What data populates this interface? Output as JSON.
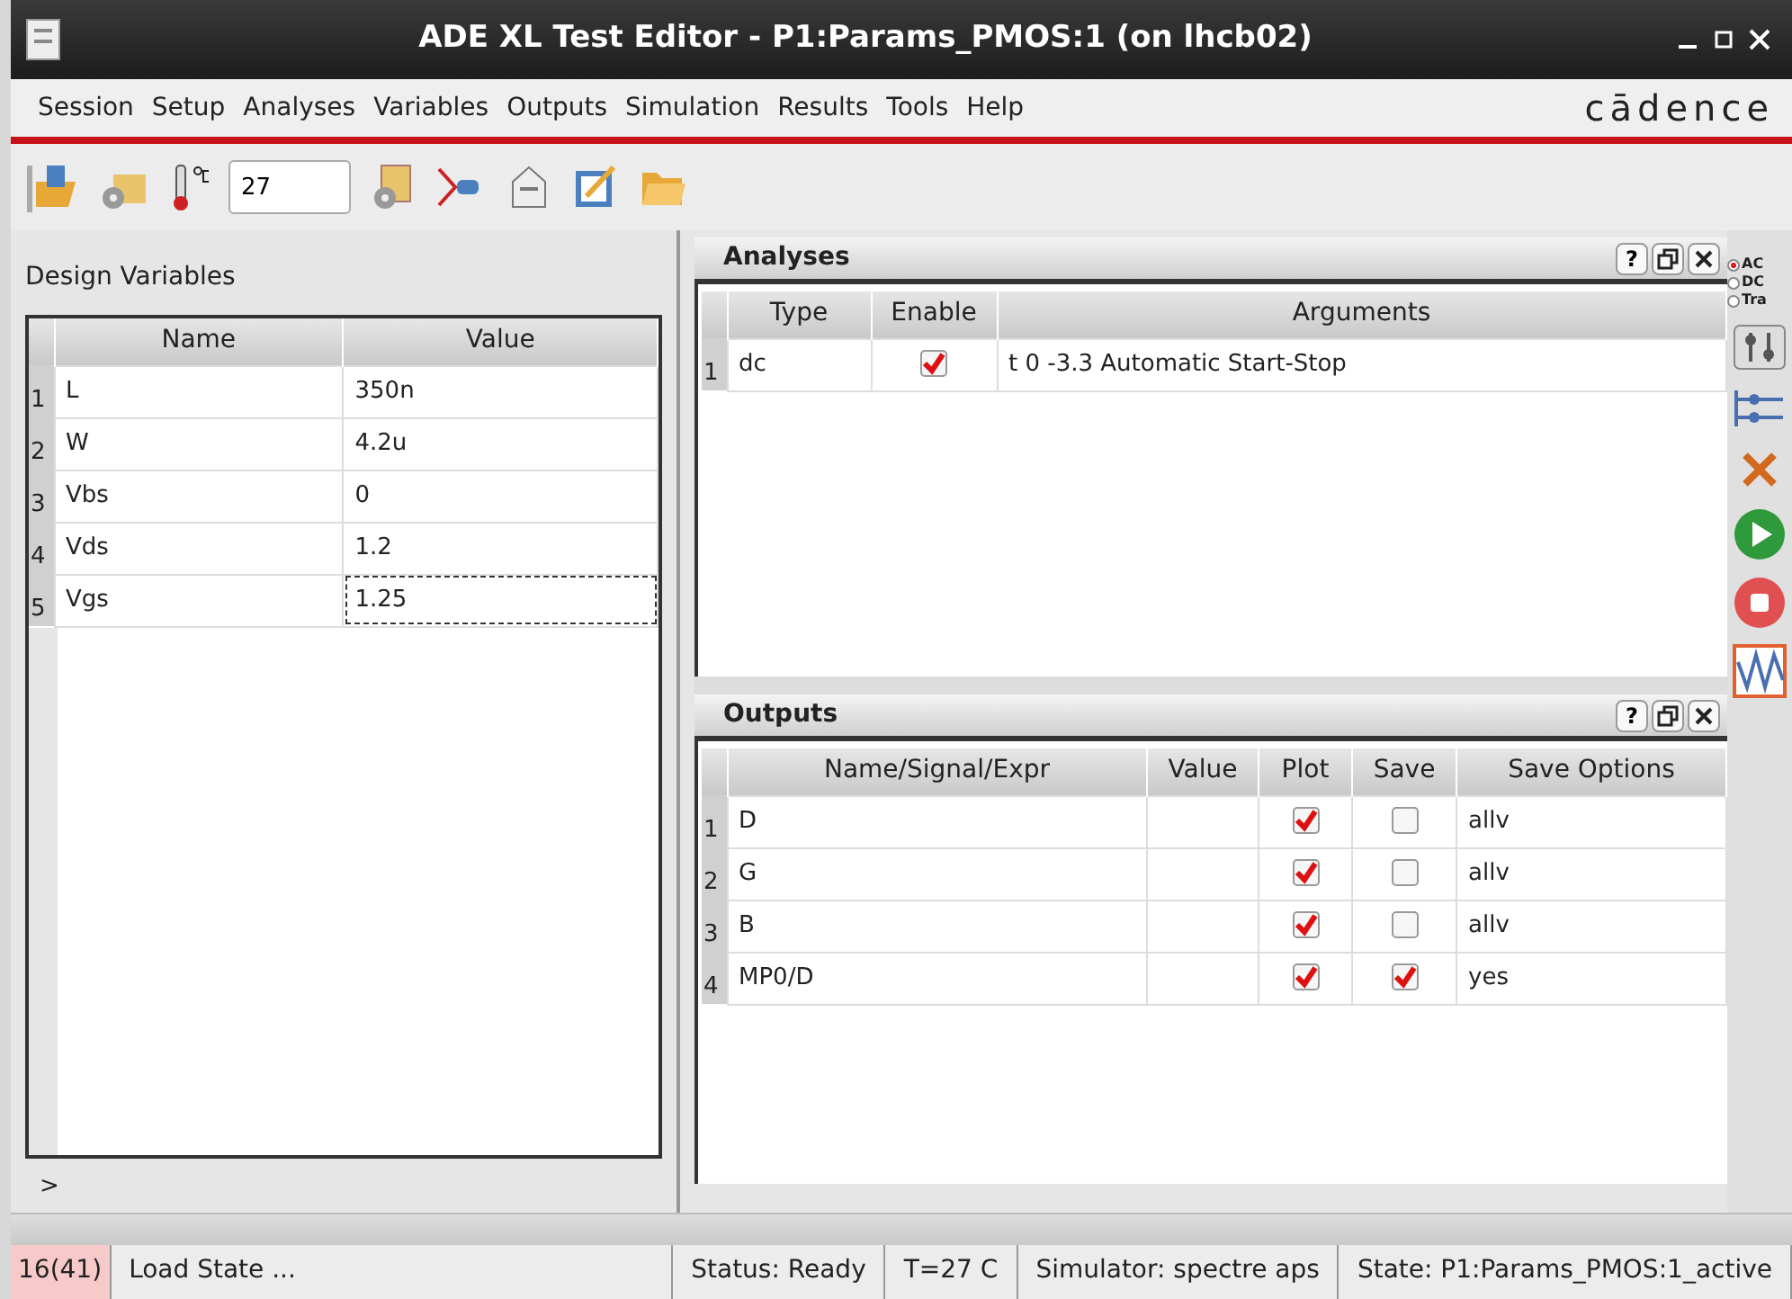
{
  "window": {
    "title": "ADE XL Test Editor - P1:Params_PMOS:1 (on lhcb02)"
  },
  "menu": [
    "Session",
    "Setup",
    "Analyses",
    "Variables",
    "Outputs",
    "Simulation",
    "Results",
    "Tools",
    "Help"
  ],
  "logo": "cādence",
  "toolbar": {
    "temperature": "27"
  },
  "design_variables": {
    "title": "Design Variables",
    "columns": [
      "Name",
      "Value"
    ],
    "expander": ">",
    "rows": [
      {
        "index": "1",
        "name": "L",
        "value": "350n",
        "focused": false
      },
      {
        "index": "2",
        "name": "W",
        "value": "4.2u",
        "focused": false
      },
      {
        "index": "3",
        "name": "Vbs",
        "value": "0",
        "focused": false
      },
      {
        "index": "4",
        "name": "Vds",
        "value": "1.2",
        "focused": false
      },
      {
        "index": "5",
        "name": "Vgs",
        "value": "1.25",
        "focused": true
      }
    ]
  },
  "analyses": {
    "title": "Analyses",
    "help": "?",
    "columns": [
      "Type",
      "Enable",
      "Arguments"
    ],
    "rows": [
      {
        "index": "1",
        "type": "dc",
        "enabled": true,
        "arguments": "t 0 -3.3 Automatic Start-Stop"
      }
    ]
  },
  "outputs": {
    "title": "Outputs",
    "help": "?",
    "columns": [
      "Name/Signal/Expr",
      "Value",
      "Plot",
      "Save",
      "Save Options"
    ],
    "rows": [
      {
        "index": "1",
        "name": "D",
        "plot": true,
        "save": false,
        "save_options": "allv"
      },
      {
        "index": "2",
        "name": "G",
        "plot": true,
        "save": false,
        "save_options": "allv"
      },
      {
        "index": "3",
        "name": "B",
        "plot": true,
        "save": false,
        "save_options": "allv"
      },
      {
        "index": "4",
        "name": "MP0/D",
        "plot": true,
        "save": true,
        "save_options": "yes"
      }
    ]
  },
  "side_toolbar": {
    "analysis_types": [
      {
        "label": "AC",
        "selected": true
      },
      {
        "label": "DC",
        "selected": false
      },
      {
        "label": "Tra",
        "selected": false
      }
    ]
  },
  "status_bar": [
    {
      "text": "16(41)",
      "highlighted": true
    },
    {
      "text": "Load State ...",
      "highlighted": false
    },
    {
      "text": "Status: Ready",
      "highlighted": false
    },
    {
      "text": "T=27 C",
      "highlighted": false
    },
    {
      "text": "Simulator: spectre aps",
      "highlighted": false
    },
    {
      "text": "State: P1:Params_PMOS:1_active",
      "highlighted": false
    }
  ]
}
